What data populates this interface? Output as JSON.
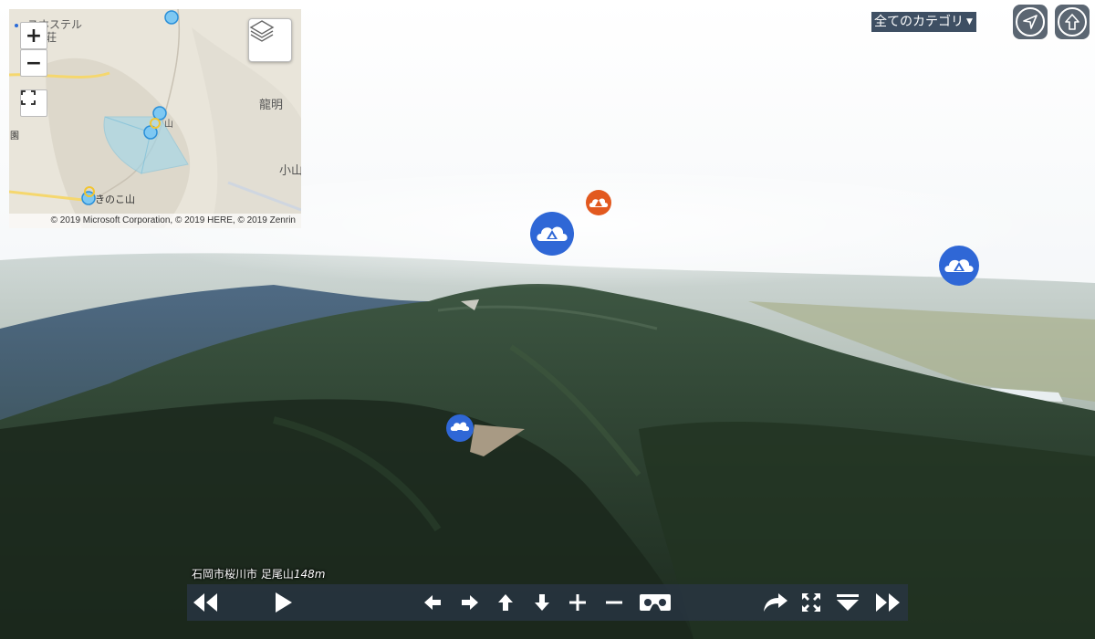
{
  "minimap": {
    "zoom_in_label": "+",
    "zoom_out_label": "−",
    "labels": {
      "hostel": "スホステル",
      "villa": "荘",
      "ryumei": "龍明",
      "koyama": "小山",
      "mountain": "山",
      "kinokoyama": "きのこ山",
      "garden": "園"
    },
    "copyright": "© 2019 Microsoft Corporation, © 2019 HERE, © 2019 Zenrin"
  },
  "top_controls": {
    "category_label": "全てのカテゴリ",
    "category_arrow": "▼"
  },
  "caption": {
    "place": "石岡市桜川市 足尾山",
    "elevation": "148m"
  },
  "colors": {
    "hotspot_blue": "#2f67d6",
    "hotspot_orange": "#e2591f",
    "bar_bg": "#283442"
  },
  "icons": {
    "hotspot": "mountain-cloud-icon",
    "download_hotspot": "cloud-download-icon"
  }
}
